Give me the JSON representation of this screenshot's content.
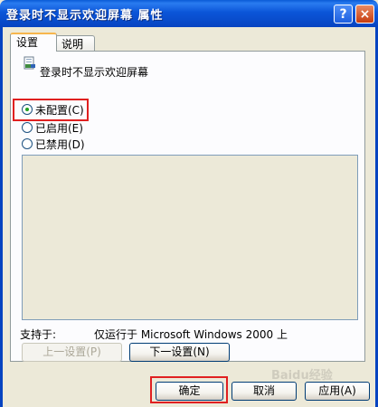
{
  "window": {
    "title": "登录时不显示欢迎屏幕 属性",
    "help_label": "?",
    "close_label": "×"
  },
  "tabs": [
    {
      "label": "设置"
    },
    {
      "label": "说明"
    }
  ],
  "policy": {
    "name": "登录时不显示欢迎屏幕"
  },
  "options": [
    {
      "label": "未配置(C)",
      "checked": true
    },
    {
      "label": "已启用(E)",
      "checked": false
    },
    {
      "label": "已禁用(D)",
      "checked": false
    }
  ],
  "support": {
    "label": "支持于:",
    "value": "仅运行于 Microsoft Windows 2000 上"
  },
  "nav": {
    "prev_label": "上一设置(P)",
    "next_label": "下一设置(N)"
  },
  "footer": {
    "ok_label": "确定",
    "cancel_label": "取消",
    "apply_label": "应用(A)"
  },
  "watermark": "Baidu经验"
}
